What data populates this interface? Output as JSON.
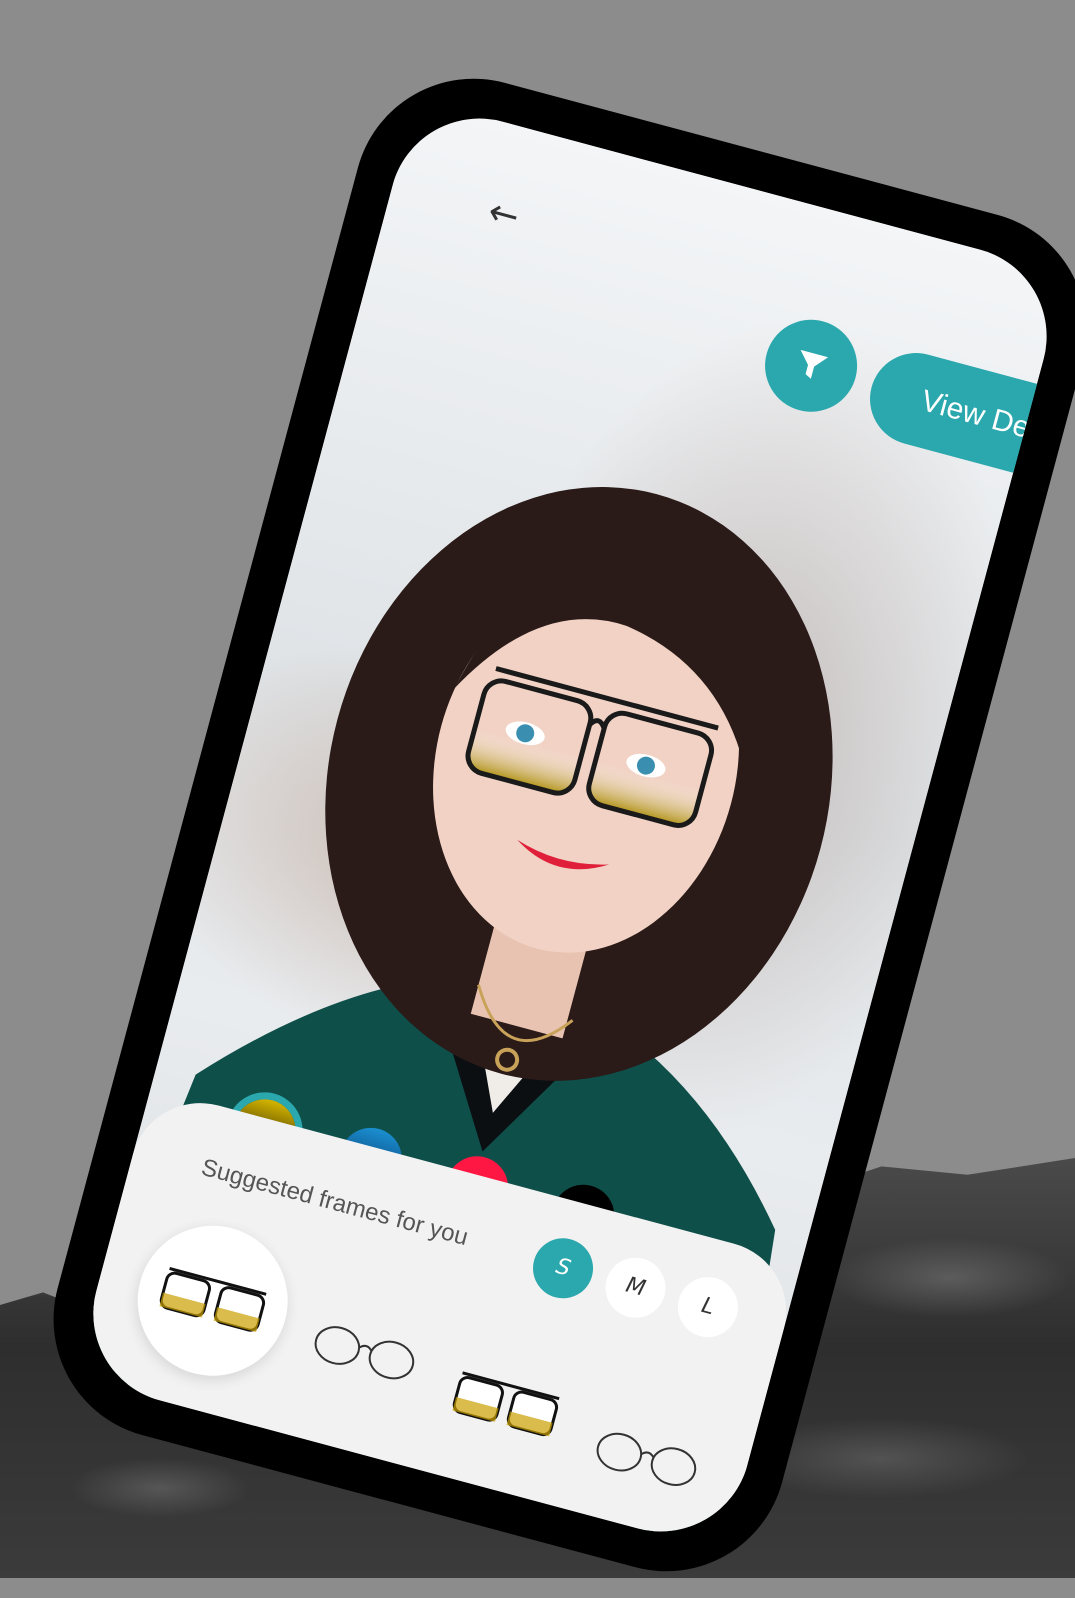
{
  "colors": {
    "accent": "#2aa8ad",
    "swatch_gold": "#a08a05",
    "swatch_blue": "#1a77b0",
    "swatch_red": "#ff1744",
    "swatch_black": "#000000"
  },
  "header": {
    "back_icon": "arrow-left-icon",
    "filter_icon": "filter-icon",
    "view_details_label": "View Details"
  },
  "swatches": [
    {
      "name": "gold",
      "selected": true
    },
    {
      "name": "blue",
      "selected": false
    },
    {
      "name": "red",
      "selected": false
    },
    {
      "name": "black",
      "selected": false
    }
  ],
  "sheet": {
    "title": "Suggested frames for you",
    "sizes": [
      {
        "label": "S",
        "selected": true
      },
      {
        "label": "M",
        "selected": false
      },
      {
        "label": "L",
        "selected": false
      }
    ],
    "frames": [
      {
        "style": "square-gold-gradient",
        "selected": true
      },
      {
        "style": "aviator-silver",
        "selected": false
      },
      {
        "style": "square-gold-gradient",
        "selected": false
      },
      {
        "style": "aviator-silver",
        "selected": false
      }
    ]
  }
}
